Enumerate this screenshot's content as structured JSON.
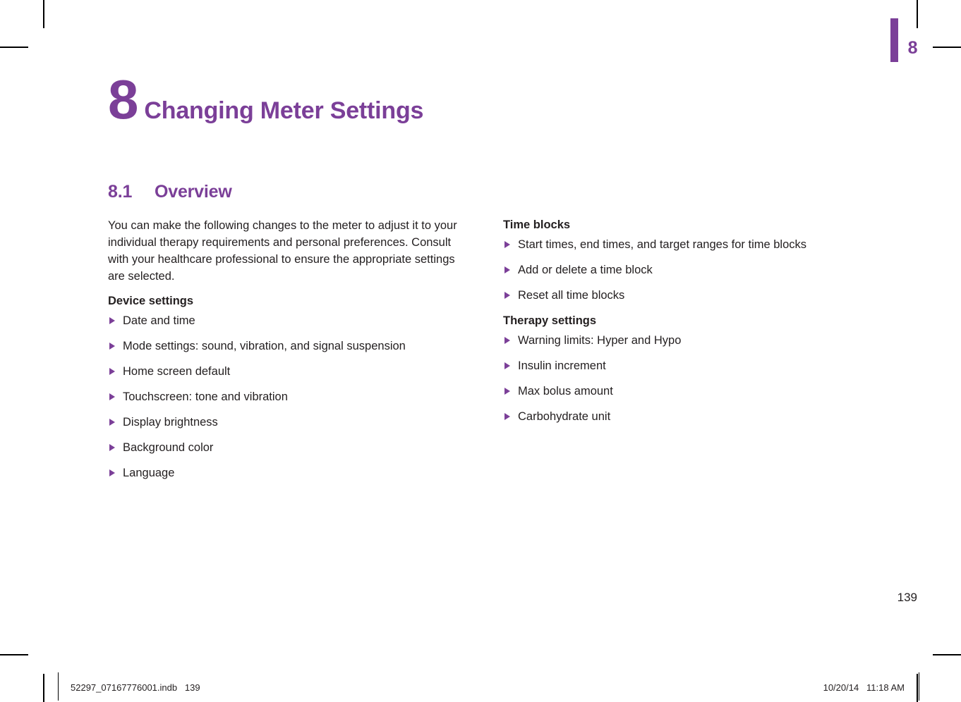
{
  "colors": {
    "brand_purple": "#7B3F98",
    "body_text": "#231F20"
  },
  "chapter_tab": {
    "number": "8"
  },
  "chapter": {
    "number": "8",
    "title": "Changing Meter Settings"
  },
  "section": {
    "number": "8.1",
    "title": "Overview"
  },
  "left_column": {
    "intro_paragraph": "You can make the following changes to the meter to adjust it to your individual therapy requirements and personal preferences. Consult with your healthcare professional to ensure the appropriate settings are selected.",
    "device_settings_heading": "Device settings",
    "device_settings_items": [
      "Date and time",
      "Mode settings: sound, vibration, and signal suspension",
      "Home screen default",
      "Touchscreen: tone and vibration",
      "Display brightness",
      "Background color",
      "Language"
    ]
  },
  "right_column": {
    "time_blocks_heading": "Time blocks",
    "time_blocks_items": [
      "Start times, end times, and target ranges for time blocks",
      "Add or delete a time block",
      "Reset all time blocks"
    ],
    "therapy_settings_heading": "Therapy settings",
    "therapy_settings_items": [
      "Warning limits: Hyper and Hypo",
      "Insulin increment",
      "Max bolus amount",
      "Carbohydrate unit"
    ]
  },
  "folio": {
    "page_number": "139"
  },
  "footer": {
    "file_name": "52297_07167776001.indb   139",
    "timestamp": "10/20/14   11:18 AM"
  },
  "icons": {
    "bullet": "triangle-right-icon"
  }
}
